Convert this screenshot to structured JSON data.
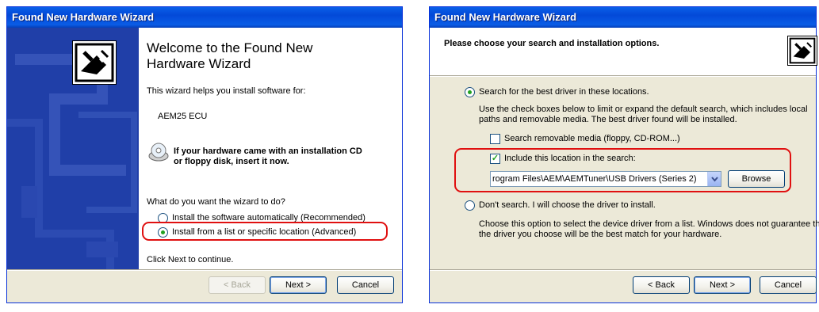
{
  "left_window": {
    "title": "Found New Hardware Wizard",
    "welcome_heading_1": "Welcome to the Found New",
    "welcome_heading_2": "Hardware Wizard",
    "intro": "This wizard helps you install software for:",
    "device": "AEM25 ECU",
    "cd_prompt_1": "If your hardware came with an installation CD",
    "cd_prompt_2": "or floppy disk, insert it now.",
    "question": "What do you want the wizard to do?",
    "option_auto": "Install the software automatically (Recommended)",
    "option_list": "Install from a list or specific location (Advanced)",
    "continue_text": "Click Next to continue.",
    "back_label": "< Back",
    "next_label": "Next >",
    "cancel_label": "Cancel"
  },
  "right_window": {
    "title": "Found New Hardware Wizard",
    "header": "Please choose your search and installation options.",
    "option_search": "Search for the best driver in these locations.",
    "search_desc_1": "Use the check boxes below to limit or expand the default search, which includes local",
    "search_desc_2": "paths and removable media. The best driver found will be installed.",
    "check_removable": "Search removable media (floppy, CD-ROM...)",
    "check_include": "Include this location in the search:",
    "location_value": "rogram Files\\AEM\\AEMTuner\\USB Drivers (Series 2)",
    "browse_label": "Browse",
    "option_dont_search": "Don't search. I will choose the driver to install.",
    "dont_desc_1": "Choose this option to select the device driver from a list.  Windows does not guarantee that",
    "dont_desc_2": "the driver you choose will be the best match for your hardware.",
    "back_label": "< Back",
    "next_label": "Next >",
    "cancel_label": "Cancel"
  },
  "colors": {
    "highlight": "#e01010",
    "xp_blue": "#0349d8",
    "dialog_bg": "#ece9d8"
  }
}
